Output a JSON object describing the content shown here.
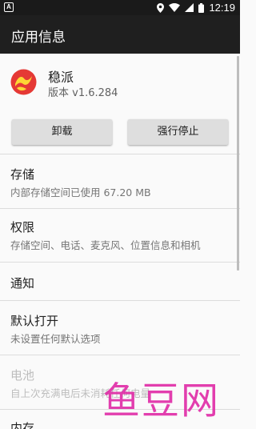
{
  "status_bar": {
    "left_icon": "A",
    "time": "12:19",
    "icons": [
      "location-icon",
      "wifi-icon",
      "signal-icon",
      "battery-icon"
    ]
  },
  "app_bar": {
    "title": "应用信息"
  },
  "app": {
    "name": "稳派",
    "version": "版本 v1.6.284",
    "icon": "wenpai-app-icon"
  },
  "buttons": {
    "uninstall": "卸载",
    "force_stop": "强行停止"
  },
  "rows": [
    {
      "title": "存储",
      "subtitle": "内部存储空间已使用 67.20 MB"
    },
    {
      "title": "权限",
      "subtitle": "存储空间、电话、麦克风、位置信息和相机"
    },
    {
      "title": "通知"
    },
    {
      "title": "默认打开",
      "subtitle": "未设置任何默认选项"
    },
    {
      "title": "电池",
      "subtitle": "自上次充满电后未消耗任何电量",
      "disabled": true
    },
    {
      "title": "内存"
    }
  ],
  "watermark": "鱼豆网",
  "colors": {
    "app_bar": "#1f1f1f",
    "status_bar": "#1a1a1a",
    "button": "#dedede",
    "watermark": "#e02aa6"
  }
}
